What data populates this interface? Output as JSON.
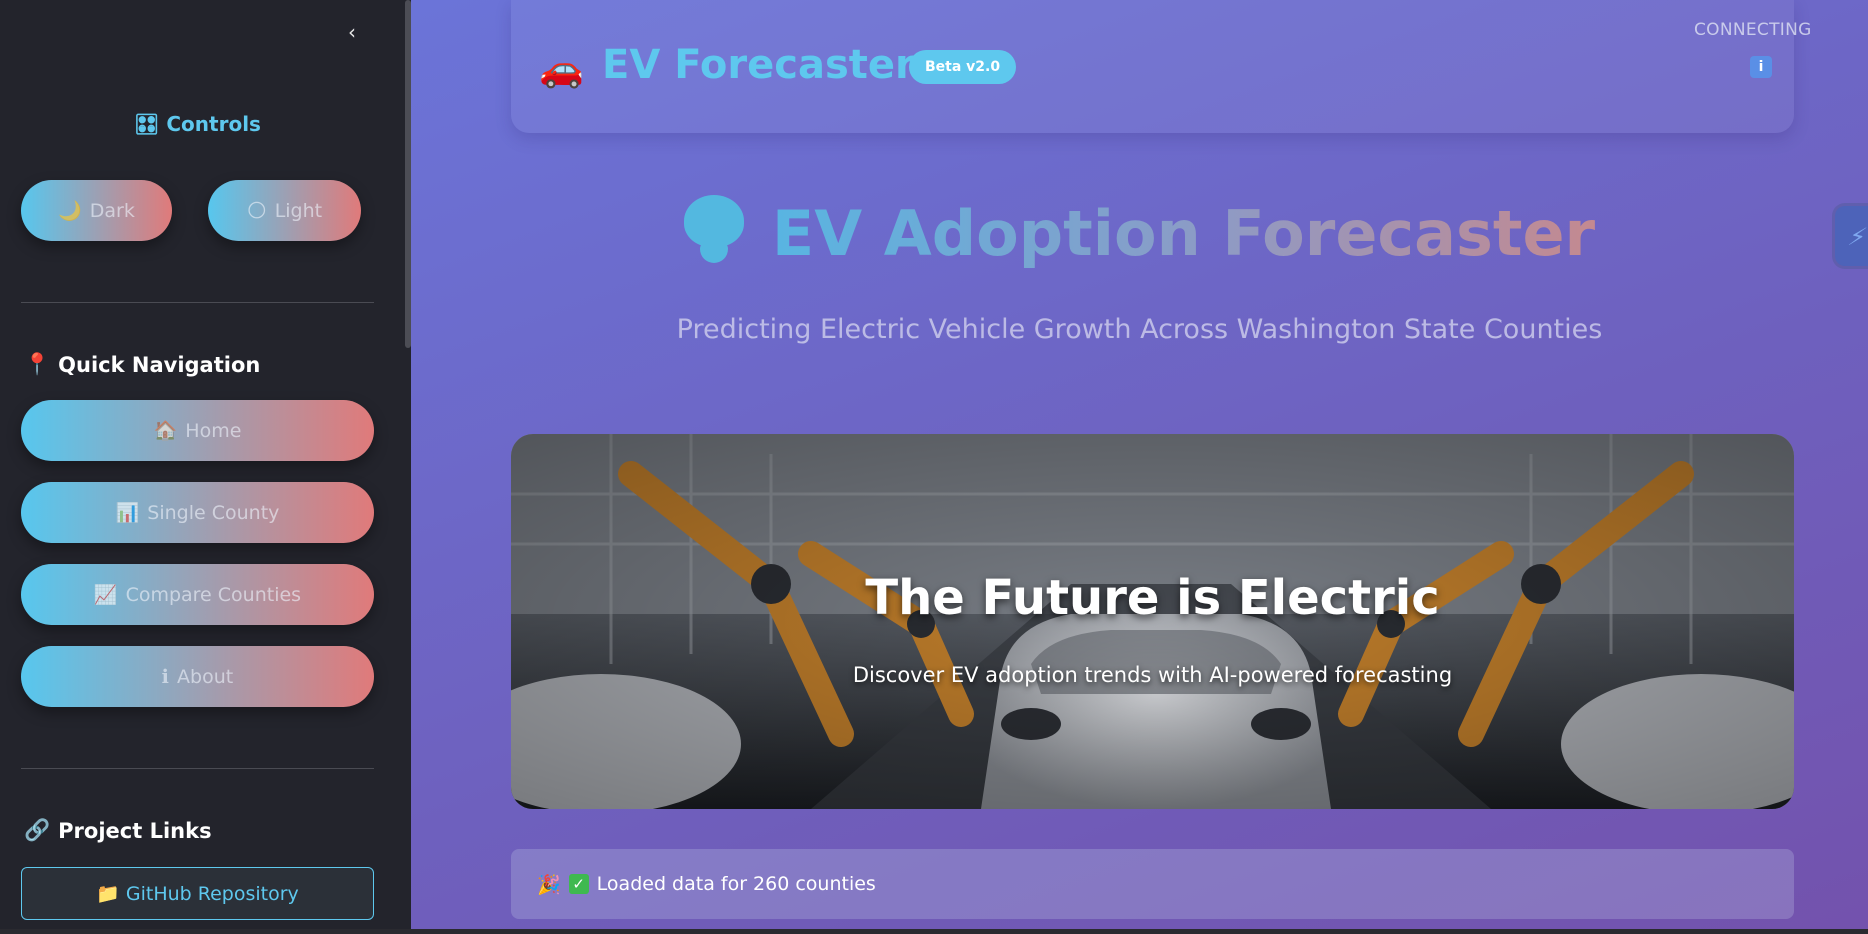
{
  "sidebar": {
    "collapse_glyph": "‹",
    "controls_title": "Controls",
    "controls_icon": "🎛",
    "theme_buttons": [
      {
        "icon": "🌙",
        "label": "Dark"
      },
      {
        "icon": "🌕",
        "label": "Light"
      }
    ],
    "quick_nav": {
      "icon": "📍",
      "title": "Quick Navigation",
      "items": [
        {
          "icon": "🏠",
          "label": "Home"
        },
        {
          "icon": "📊",
          "label": "Single County"
        },
        {
          "icon": "📈",
          "label": "Compare Counties"
        },
        {
          "icon": "ℹ",
          "label": "About"
        }
      ]
    },
    "project_links": {
      "icon": "🔗",
      "title": "Project Links",
      "repo_icon": "📁",
      "repo_label": "GitHub Repository"
    }
  },
  "header": {
    "brand_icon": "🚗",
    "brand_title": "EV Forecaster",
    "badge": "Beta v2.0",
    "connection_status": "CONNECTING",
    "info_glyph": "i"
  },
  "hero": {
    "title": "EV Adoption Forecaster",
    "subtitle": "Predicting Electric Vehicle Growth Across Washington State Counties"
  },
  "banner": {
    "title": "The Future is Electric",
    "subtitle": "Discover EV adoption trends with AI-powered forecasting"
  },
  "status": {
    "icon": "🎉",
    "check": "✓",
    "message": "Loaded data for 260 counties"
  }
}
